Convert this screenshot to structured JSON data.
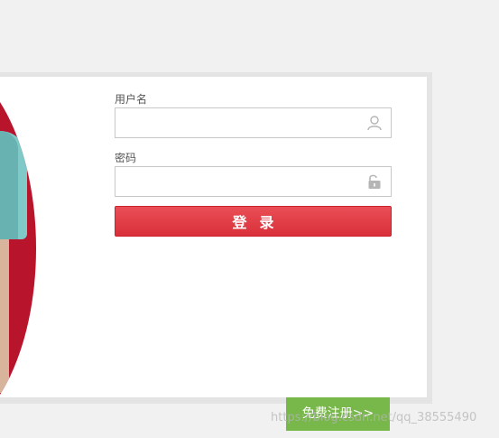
{
  "login": {
    "username_label": "用户名",
    "username_value": "",
    "password_label": "密码",
    "password_value": "",
    "submit_label": "登录",
    "register_label": "免费注册>>"
  },
  "icons": {
    "username_icon": "user-icon",
    "password_icon": "lock-icon"
  },
  "colors": {
    "accent_red": "#e0363f",
    "banner_red": "#b8152c",
    "register_green": "#78b84a"
  },
  "watermark": "https://blog.csdn.net/qq_38555490"
}
